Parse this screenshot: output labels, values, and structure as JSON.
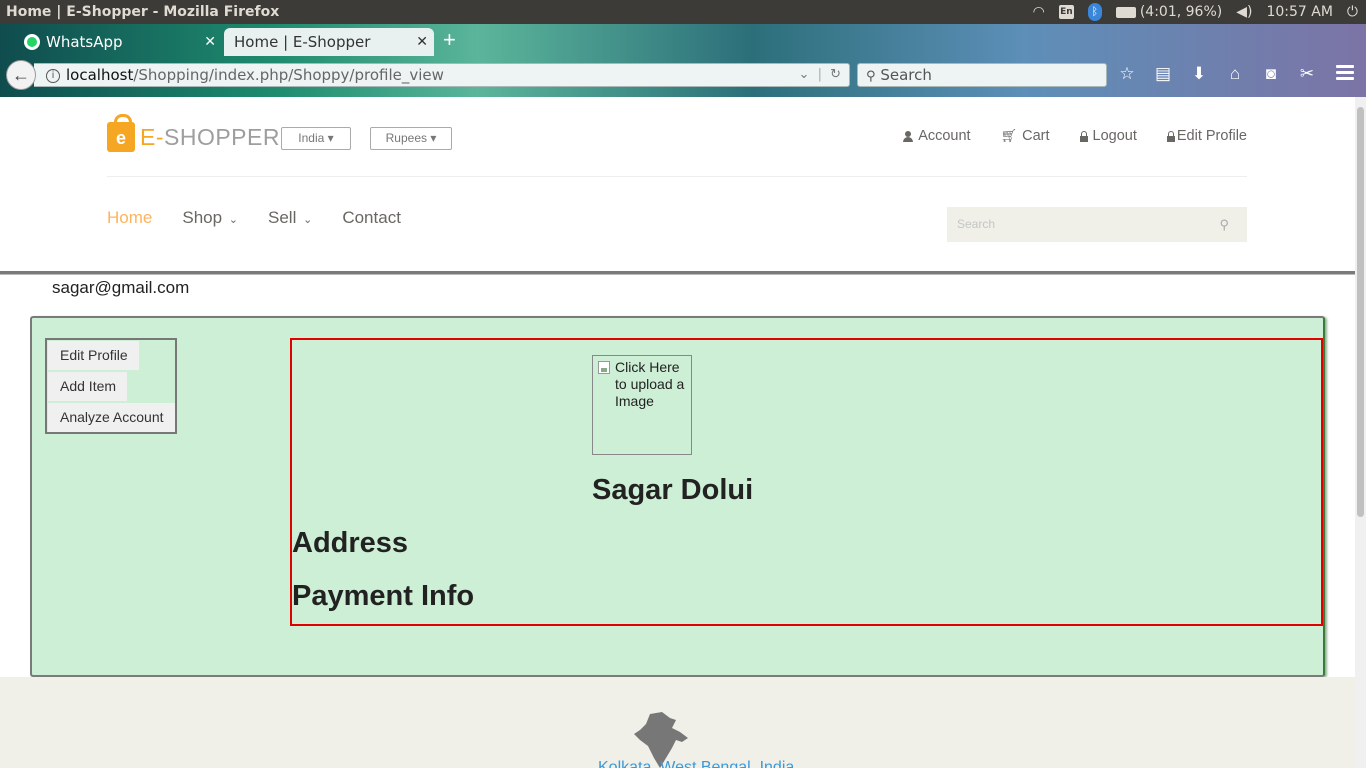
{
  "os": {
    "window_title": "Home | E-Shopper - Mozilla Firefox",
    "lang": "En",
    "battery": "(4:01, 96%)",
    "time": "10:57 AM"
  },
  "browser": {
    "tabs": [
      {
        "label": "WhatsApp",
        "active": false
      },
      {
        "label": "Home | E-Shopper",
        "active": true
      }
    ],
    "url_host": "localhost",
    "url_path": "/Shopping/index.php/Shoppy/profile_view",
    "search_placeholder": "Search"
  },
  "site": {
    "logo_e": "E-",
    "logo_rest": "SHOPPER",
    "logo_badge": "e",
    "country_dropdown": "India",
    "currency_dropdown": "Rupees",
    "top_links": {
      "account": "Account",
      "cart": "Cart",
      "logout": "Logout",
      "edit_profile": "Edit Profile"
    },
    "nav": {
      "home": "Home",
      "shop": "Shop",
      "sell": "Sell",
      "contact": "Contact"
    },
    "search_placeholder": "Search"
  },
  "profile": {
    "email": "sagar@gmail.com",
    "menu": {
      "edit_profile": "Edit Profile",
      "add_item": "Add Item",
      "analyze_account": "Analyze Account"
    },
    "image_alt": "Click Here to upload a Image",
    "name": "Sagar Dolui",
    "address_heading": "Address",
    "payment_heading": "Payment Info"
  },
  "footer": {
    "location": "Kolkata, West Bengal, India"
  },
  "colors": {
    "accent": "#fdb45e",
    "panel_bg": "#cdefd5",
    "content_border": "#e00000",
    "link": "#3a9ad9"
  }
}
